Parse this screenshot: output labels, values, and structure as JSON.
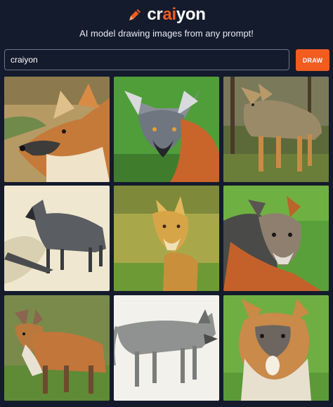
{
  "header": {
    "logo_parts": [
      "cr",
      "ai",
      "yon"
    ],
    "logo_icon": "pencil-icon",
    "tagline": "AI model drawing images from any prompt!"
  },
  "search": {
    "value": "craiyon",
    "button_label": "DRAW"
  },
  "colors": {
    "background": "#141b2c",
    "accent": "#f25c1f"
  },
  "results": [
    {
      "subject": "gray-orange fox head in profile",
      "style": "painting"
    },
    {
      "subject": "gray-faced fox on green grass",
      "style": "painting"
    },
    {
      "subject": "coyote-like fox walking in forest",
      "style": "painting"
    },
    {
      "subject": "gray wolf standing",
      "style": "sketch"
    },
    {
      "subject": "yellow fox on green field",
      "style": "painting"
    },
    {
      "subject": "fox lying in grass",
      "style": "painting"
    },
    {
      "subject": "red-gray fox standing on grass",
      "style": "photo"
    },
    {
      "subject": "gray wolf walking",
      "style": "sketch"
    },
    {
      "subject": "fox with open mouth on grass",
      "style": "painting"
    }
  ]
}
